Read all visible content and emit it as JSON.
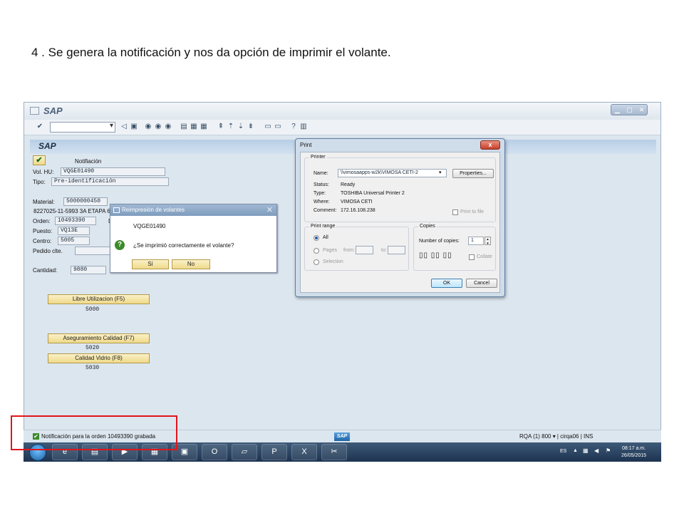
{
  "caption": "4 . Se genera la notificación y nos da opción de imprimir el volante.",
  "window": {
    "title": "SAP"
  },
  "header": {
    "title": "SAP"
  },
  "form": {
    "title": "Notifiación",
    "vol_hu_label": "Vol. HU:",
    "vol_hu": "VQGE01490",
    "tipo_label": "Tipo:",
    "tipo": "Pre-identificación",
    "material_label": "Material:",
    "material": "5000000450",
    "material_desc": "8227025-11-5993 3A ETAPA 6",
    "orden_label": "Orden:",
    "orden": "10493390",
    "puesto_label": "Puesto:",
    "puesto": "VQ13E",
    "centro_label": "Centro:",
    "centro": "5005",
    "pedido_label": "Pedido clte.",
    "pedido": "",
    "cantidad_label": "Cantidad:",
    "cantidad": "9880"
  },
  "buttons": [
    {
      "label": "Libre Utilizacion (F5)",
      "value": "5000"
    },
    {
      "label": "Aseguramiento Calidad (F7)",
      "value": "5020"
    },
    {
      "label": "Calidad Vidrio (F8)",
      "value": "5030"
    }
  ],
  "reimp_dialog": {
    "title": "Reimpresión de volantes",
    "hu": "VQGE01490",
    "question": "¿Se imprimió correctamente el volante?",
    "yes": "Sí",
    "no": "No"
  },
  "print_dialog": {
    "title": "Print",
    "close": "x",
    "printer_group": "Printer",
    "name_label": "Name:",
    "name_value": "\\\\vimosaapps-w2k\\VIMOSA CETI-2",
    "properties": "Properties...",
    "status_label": "Status:",
    "status_value": "Ready",
    "type_label": "Type:",
    "type_value": "TOSHIBA Universal Printer 2",
    "where_label": "Where:",
    "where_value": "VIMOSA CETI",
    "comment_label": "Comment:",
    "comment_value": "172.16.108.238",
    "print_to_file": "Print to file",
    "range_group": "Print range",
    "all": "All",
    "pages": "Pages",
    "from": "from:",
    "to": "to:",
    "selection": "Selection",
    "copies_group": "Copies",
    "num_copies_label": "Number of copies:",
    "num_copies": "1",
    "collate": "Collate",
    "ok": "OK",
    "cancel": "Cancel"
  },
  "status_bar": {
    "message": "Notificación para la orden 10493390 grabada",
    "sap_logo": "SAP",
    "sysinfo": "RQA (1) 800 ▾  |  cirqa06  |  INS"
  },
  "taskbar": {
    "lang": "ES",
    "time": "08:17 a.m.",
    "date": "26/05/2015"
  },
  "colors": {
    "highlight": "#e0161b",
    "sap_header": "#b8cee6",
    "button_yellow": "#efd98a"
  }
}
